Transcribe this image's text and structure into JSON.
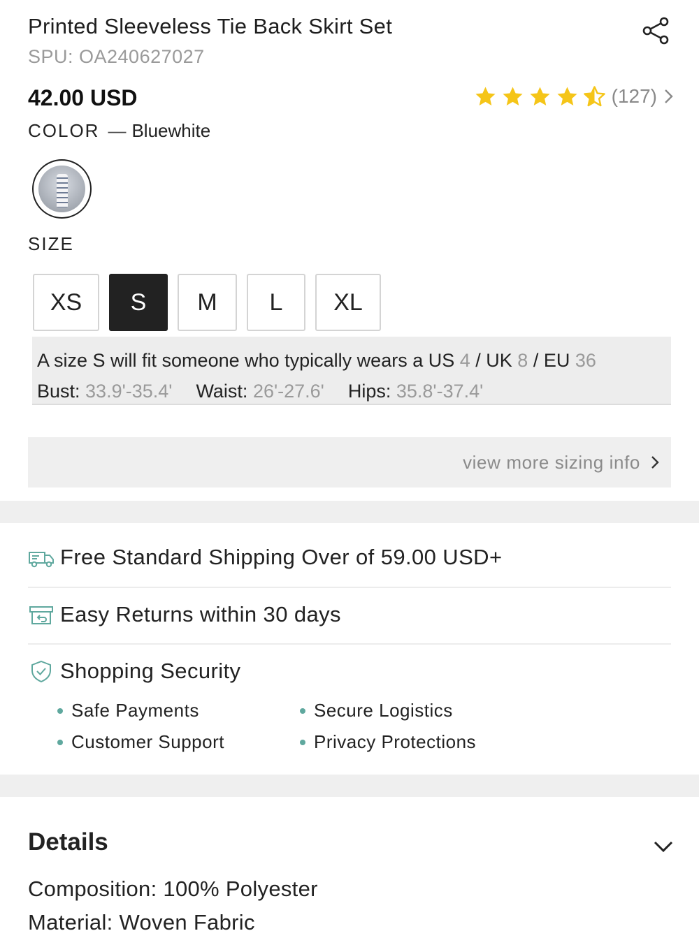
{
  "product": {
    "title": "Printed Sleeveless Tie Back Skirt Set",
    "spu": "SPU: OA240627027",
    "price": "42.00 USD",
    "rating": {
      "stars": 4.5,
      "count": "(127)"
    }
  },
  "color": {
    "label": "COLOR",
    "dash": "—",
    "value": "Bluewhite"
  },
  "size": {
    "label": "SIZE",
    "options": [
      "XS",
      "S",
      "M",
      "L",
      "XL"
    ],
    "selected": "S"
  },
  "fit": {
    "line1_prefix": "A size S will fit someone who typically wears a US ",
    "us": "4",
    "uk_label": " / UK ",
    "uk": "8",
    "eu_label": " / EU ",
    "eu": "36",
    "bust_label": "Bust: ",
    "bust": "33.9'-35.4'",
    "waist_label": "Waist: ",
    "waist": "26'-27.6'",
    "hips_label": "Hips: ",
    "hips": "35.8'-37.4'"
  },
  "more_sizing": "view more sizing info",
  "services": {
    "shipping": "Free Standard Shipping Over of 59.00 USD+",
    "returns": "Easy Returns within 30 days",
    "security": "Shopping Security",
    "security_items": [
      "Safe Payments",
      "Secure Logistics",
      "Customer Support",
      "Privacy Protections"
    ]
  },
  "details": {
    "title": "Details",
    "lines": [
      "Composition: 100% Polyester",
      "Material: Woven Fabric"
    ]
  },
  "colors": {
    "accent": "#5fa89e",
    "star": "#f5c518",
    "selected_size_bg": "#222222"
  }
}
